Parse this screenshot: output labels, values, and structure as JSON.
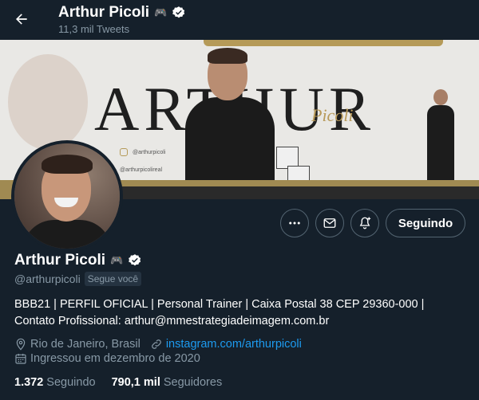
{
  "header": {
    "name": "Arthur Picoli",
    "name_emoji": "🎮",
    "tweet_count": "11,3 mil Tweets"
  },
  "banner": {
    "big_word": "ARTHUR",
    "script_word": "Picoli",
    "ig_handle": "@arthurpicoli",
    "ig_handle2": "@arthurpicolireal"
  },
  "actions": {
    "follow_label": "Seguindo"
  },
  "profile": {
    "name": "Arthur Picoli",
    "name_emoji": "🎮",
    "handle": "@arthurpicoli",
    "follows_you": "Segue você",
    "bio_line1": "BBB21 | PERFIL OFICIAL | Personal Trainer | Caixa Postal 38 CEP 29360-000 |",
    "bio_line2": "Contato Profissional: arthur@mmestrategiadeimagem.com.br",
    "location": "Rio de Janeiro, Brasil",
    "website": "instagram.com/arthurpicoli",
    "joined": "Ingressou em dezembro de 2020"
  },
  "stats": {
    "following_count": "1.372",
    "following_label": "Seguindo",
    "followers_count": "790,1 mil",
    "followers_label": "Seguidores"
  },
  "colors": {
    "background": "#15202b",
    "accent": "#1d9bf0",
    "muted": "#8899a6",
    "banner_gold": "#b59a58"
  }
}
